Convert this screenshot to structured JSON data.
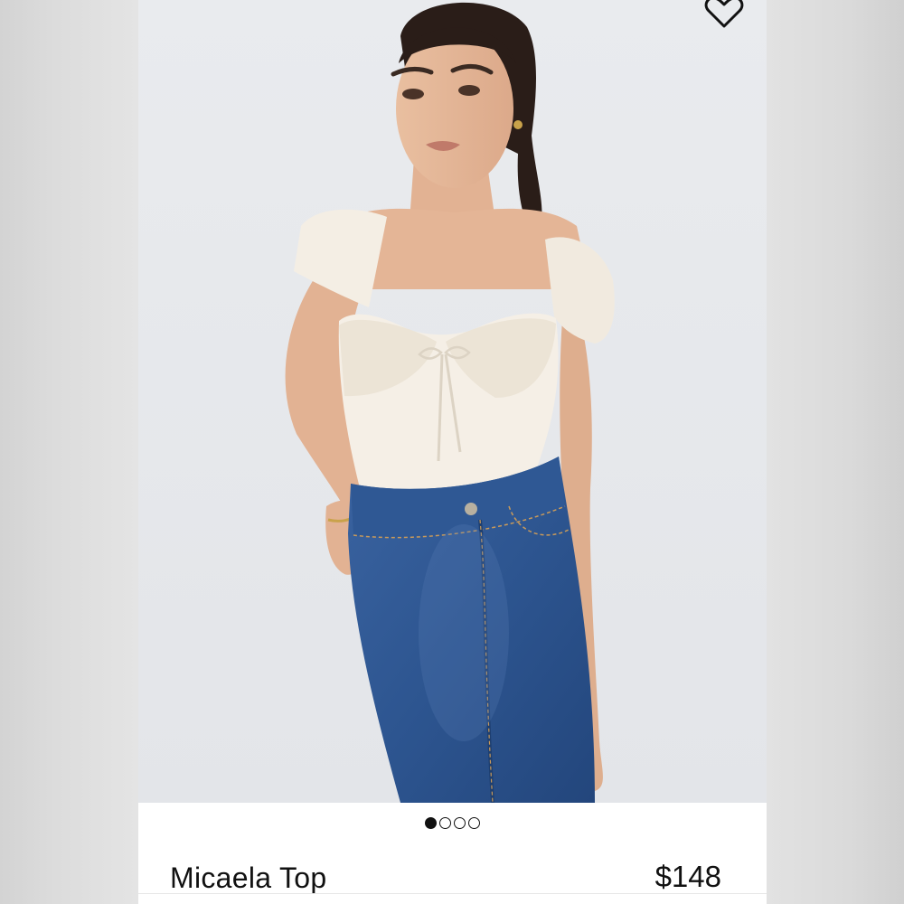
{
  "product": {
    "name": "Micaela Top",
    "price": "$148"
  },
  "wishlist": {
    "icon": "heart-outline-icon"
  },
  "image": {
    "carousel": {
      "count": 4,
      "active_index": 0
    }
  },
  "colors": {
    "text": "#111111",
    "image_background": "#e6e8ec",
    "top_fabric": "#f4eee4",
    "denim": "#2d5590"
  }
}
